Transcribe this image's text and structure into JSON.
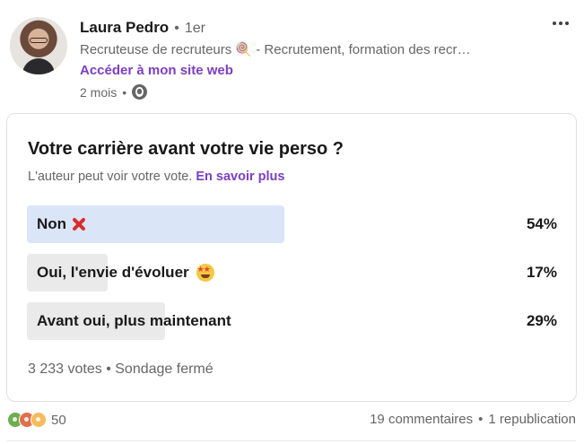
{
  "author": {
    "name": "Laura Pedro",
    "separator": "•",
    "degree": "1er",
    "headline": "Recruteuse de recruteurs 🍭 - Recrutement, formation des recr…",
    "site_link": "Accéder à mon site web",
    "time_ago": "2 mois",
    "visibility_icon": "globe-icon"
  },
  "poll": {
    "question": "Votre carrière avant votre vie perso ?",
    "note": "L'auteur peut voir votre vote.",
    "learn_more": "En savoir plus",
    "options": [
      {
        "label": "Non",
        "emoji": "cross-mark-icon",
        "percent_label": "54%",
        "share": 0.54,
        "selected": true
      },
      {
        "label": "Oui, l'envie d'évoluer",
        "emoji": "star-struck-icon",
        "percent_label": "17%",
        "share": 0.17,
        "selected": false
      },
      {
        "label": "Avant oui, plus maintenant",
        "emoji": "",
        "percent_label": "29%",
        "share": 0.29,
        "selected": false
      }
    ],
    "votes": "3 233 votes",
    "status": "Sondage fermé",
    "separator": "•"
  },
  "social": {
    "reaction_icons": [
      "clap-icon",
      "heart-icon",
      "bulb-icon"
    ],
    "reaction_count": "50",
    "comments": "19 commentaires",
    "separator": "•",
    "reposts": "1 republication"
  },
  "colors": {
    "accent_link": "#7b3fc4",
    "selected_fill": "#dbe5f8",
    "option_fill": "#eaeaea"
  }
}
